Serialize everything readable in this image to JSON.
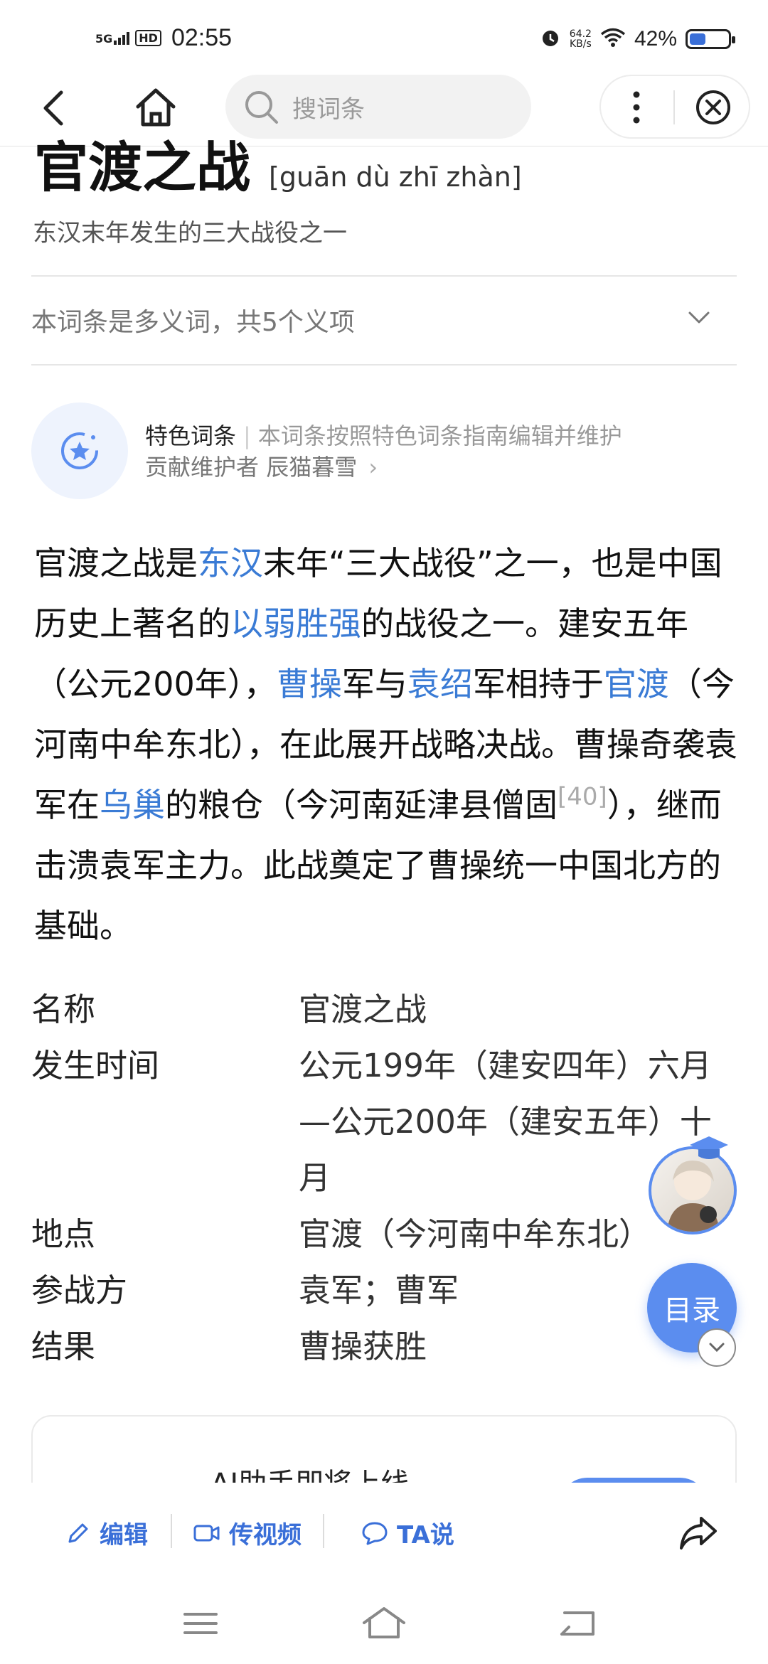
{
  "status_bar": {
    "network": "5G",
    "hd": "HD",
    "time": "02:55",
    "speed_value": "64.2",
    "speed_unit": "KB/s",
    "battery_text": "42%",
    "battery_level": 0.42
  },
  "nav": {
    "search_placeholder": "搜词条"
  },
  "entry": {
    "title": "官渡之战",
    "pinyin": "[guān dù zhī zhàn]",
    "subtitle": "东汉末年发生的三大战役之一",
    "polysemy": "本词条是多义词，共5个义项"
  },
  "featured": {
    "label": "特色词条",
    "separator": "|",
    "description": "本词条按照特色词条指南编辑并维护",
    "contributor_label": "贡献维护者",
    "contributor": "辰猫暮雪",
    "arrow": "›"
  },
  "summary": {
    "t1": "官渡之战是",
    "l1": "东汉",
    "t2": "末年“三大战役”之一，也是中国历史上著名的",
    "l2": "以弱胜强",
    "t3": "的战役之一。建安五年（公元200年），",
    "l3": "曹操",
    "t4": "军与",
    "l4": "袁绍",
    "t5": "军相持于",
    "l5": "官渡",
    "t6": "（今河南中牟东北），在此展开战略决战。曹操奇袭袁军在",
    "l6": "乌巢",
    "t7": "的粮仓（今河南延津县僧固",
    "ref": "[40]",
    "t8": "），继而击溃袁军主力。此战奠定了曹操统一中国北方的基础。"
  },
  "infobox": [
    {
      "key": "名称",
      "value": "官渡之战"
    },
    {
      "key": "发生时间",
      "value": "公元199年（建安四年）六月—公元200年（建安五年）十月"
    },
    {
      "key": "地点",
      "value": "官渡（今河南中牟东北）"
    },
    {
      "key": "参战方",
      "value": "袁军；曹军"
    },
    {
      "key": "结果",
      "value": "曹操获胜"
    }
  ],
  "toc_button": "目录",
  "ai_card": {
    "text": "AI助手即将上线"
  },
  "actions": {
    "edit": "编辑",
    "video": "传视频",
    "ta": "TA说"
  },
  "colors": {
    "link": "#3a7bd5",
    "accent": "#5b8def",
    "action": "#3a6fd8"
  }
}
